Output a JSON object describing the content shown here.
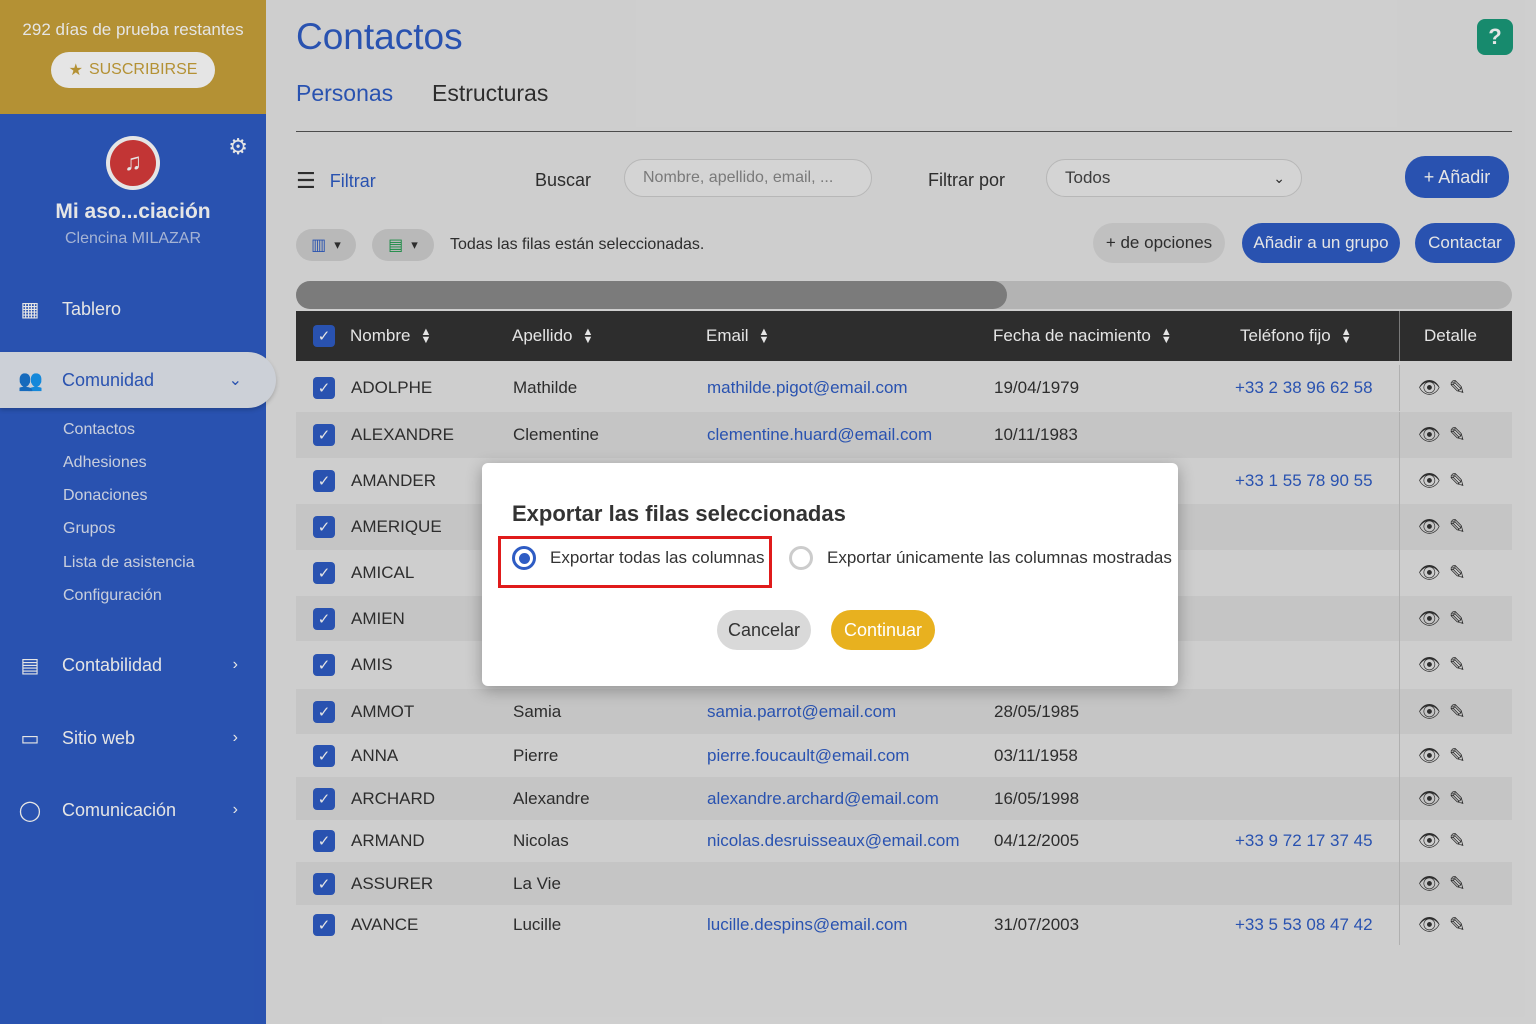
{
  "sidebar": {
    "trial_text": "292 días de prueba restantes",
    "subscribe_label": "SUSCRIBIRSE",
    "org_name": "Mi aso...ciación",
    "user_name": "Clencina MILAZAR",
    "nav": {
      "tablero": "Tablero",
      "comunidad": "Comunidad",
      "contabilidad": "Contabilidad",
      "sitio_web": "Sitio web",
      "comunicacion": "Comunicación"
    },
    "subitems": [
      "Contactos",
      "Adhesiones",
      "Donaciones",
      "Grupos",
      "Lista de asistencia",
      "Configuración"
    ]
  },
  "header": {
    "title": "Contactos",
    "help": "?",
    "tabs": [
      "Personas",
      "Estructuras"
    ]
  },
  "toolbar": {
    "filter_label": "Filtrar",
    "search_label": "Buscar",
    "search_placeholder": "Nombre, apellido, email, ...",
    "filter_by_label": "Filtrar por",
    "filter_by_value": "Todos",
    "add_label": "+ Añadir",
    "selection_msg": "Todas las filas están seleccionadas.",
    "more_options_label": "+ de opciones",
    "add_group_label": "Añadir a un grupo",
    "contact_label": "Contactar"
  },
  "table": {
    "headers": {
      "nombre": "Nombre",
      "apellido": "Apellido",
      "email": "Email",
      "fecha": "Fecha de nacimiento",
      "telefono": "Teléfono fijo",
      "detalle": "Detalle"
    },
    "rows": [
      {
        "nombre": "ADOLPHE",
        "apellido": "Mathilde",
        "email": "mathilde.pigot@email.com",
        "fecha": "19/04/1979",
        "telefono": "+33 2 38 96 62 58"
      },
      {
        "nombre": "ALEXANDRE",
        "apellido": "Clementine",
        "email": "clementine.huard@email.com",
        "fecha": "10/11/1983",
        "telefono": ""
      },
      {
        "nombre": "AMANDER",
        "apellido": "",
        "email": "",
        "fecha": "",
        "telefono": "+33 1 55 78 90 55"
      },
      {
        "nombre": "AMERIQUE",
        "apellido": "",
        "email": "",
        "fecha": "",
        "telefono": ""
      },
      {
        "nombre": "AMICAL",
        "apellido": "",
        "email": "",
        "fecha": "",
        "telefono": ""
      },
      {
        "nombre": "AMIEN",
        "apellido": "",
        "email": "",
        "fecha": "",
        "telefono": ""
      },
      {
        "nombre": "AMIS",
        "apellido": "",
        "email": "",
        "fecha": "",
        "telefono": ""
      },
      {
        "nombre": "AMMOT",
        "apellido": "Samia",
        "email": "samia.parrot@email.com",
        "fecha": "28/05/1985",
        "telefono": ""
      },
      {
        "nombre": "ANNA",
        "apellido": "Pierre",
        "email": "pierre.foucault@email.com",
        "fecha": "03/11/1958",
        "telefono": ""
      },
      {
        "nombre": "ARCHARD",
        "apellido": "Alexandre",
        "email": "alexandre.archard@email.com",
        "fecha": "16/05/1998",
        "telefono": ""
      },
      {
        "nombre": "ARMAND",
        "apellido": "Nicolas",
        "email": "nicolas.desruisseaux@email.com",
        "fecha": "04/12/2005",
        "telefono": "+33 9 72 17 37 45"
      },
      {
        "nombre": "ASSURER",
        "apellido": "La Vie",
        "email": "",
        "fecha": "",
        "telefono": ""
      },
      {
        "nombre": "AVANCE",
        "apellido": "Lucille",
        "email": "lucille.despins@email.com",
        "fecha": "31/07/2003",
        "telefono": "+33 5 53 08 47 42"
      }
    ]
  },
  "modal": {
    "title": "Exportar las filas seleccionadas",
    "option_all": "Exportar todas las columnas",
    "option_shown": "Exportar únicamente las columnas mostradas",
    "selected_option": "option_all",
    "cancel_label": "Cancelar",
    "continue_label": "Continuar"
  },
  "colors": {
    "primary": "#2e5cc4",
    "trial_bar": "#c9a23a",
    "continue": "#e8b11f",
    "highlight": "#e01b1b",
    "help": "#1a9a7a"
  }
}
